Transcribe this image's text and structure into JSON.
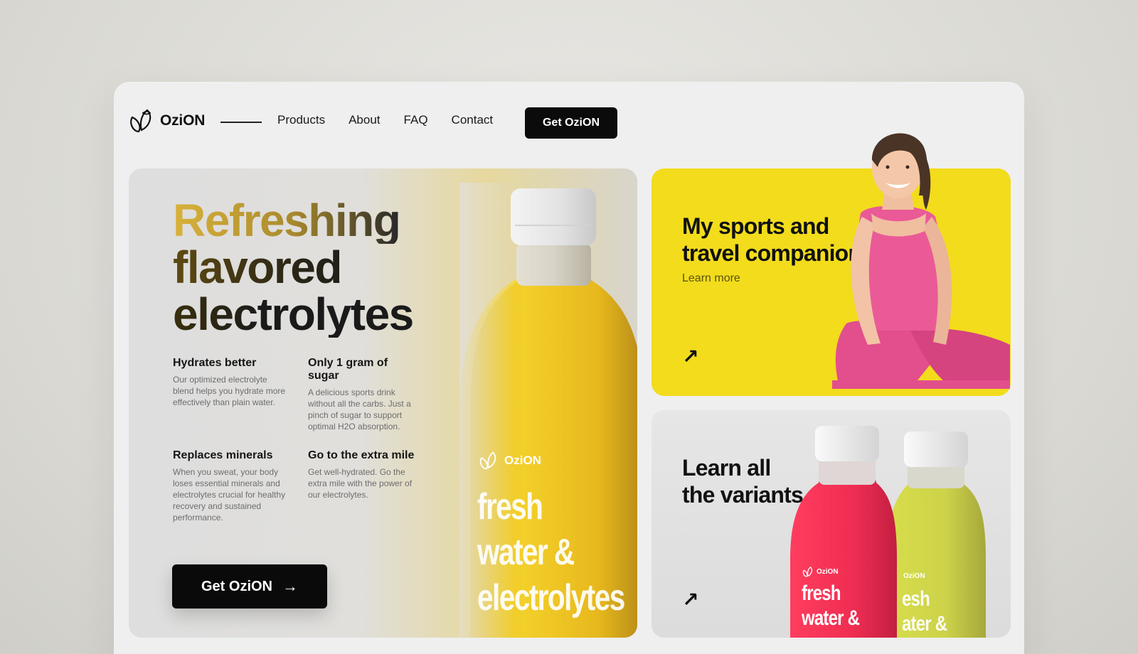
{
  "brand": {
    "name": "OziON"
  },
  "nav": {
    "links": [
      "Products",
      "About",
      "FAQ",
      "Contact"
    ],
    "cta": "Get OziON"
  },
  "hero": {
    "title_lines": [
      "Refreshing",
      "flavored",
      "electrolytes"
    ],
    "features": [
      {
        "title": "Hydrates better",
        "text": "Our optimized electrolyte blend helps you hydrate more effectively than plain water."
      },
      {
        "title": "Only 1 gram of sugar",
        "text": "A delicious sports drink without all the carbs. Just a pinch of sugar to support optimal H2O absorption."
      },
      {
        "title": "Replaces minerals",
        "text": "When you sweat, your body loses essential minerals and electrolytes crucial for healthy recovery and sustained performance."
      },
      {
        "title": "Go to the extra mile",
        "text": "Get well-hydrated. Go the extra mile with the power of our electrolytes."
      }
    ],
    "cta": "Get OziON",
    "bottle_label": {
      "brand": "OziON",
      "lines": [
        "fresh",
        "water &",
        "electrolytes"
      ]
    }
  },
  "card_sports": {
    "title_lines": [
      "My sports and",
      "travel companion"
    ],
    "link": "Learn more"
  },
  "card_variants": {
    "title_lines": [
      "Learn all",
      "the variants"
    ],
    "bottle_labels": {
      "brand": "OziON",
      "red_lines": [
        "fresh",
        "water &"
      ],
      "green_lines": [
        "esh",
        "ater &"
      ]
    }
  },
  "colors": {
    "accent_yellow": "#f2dc1c",
    "pink": "#e8457f",
    "button_black": "#0b0b0b"
  }
}
